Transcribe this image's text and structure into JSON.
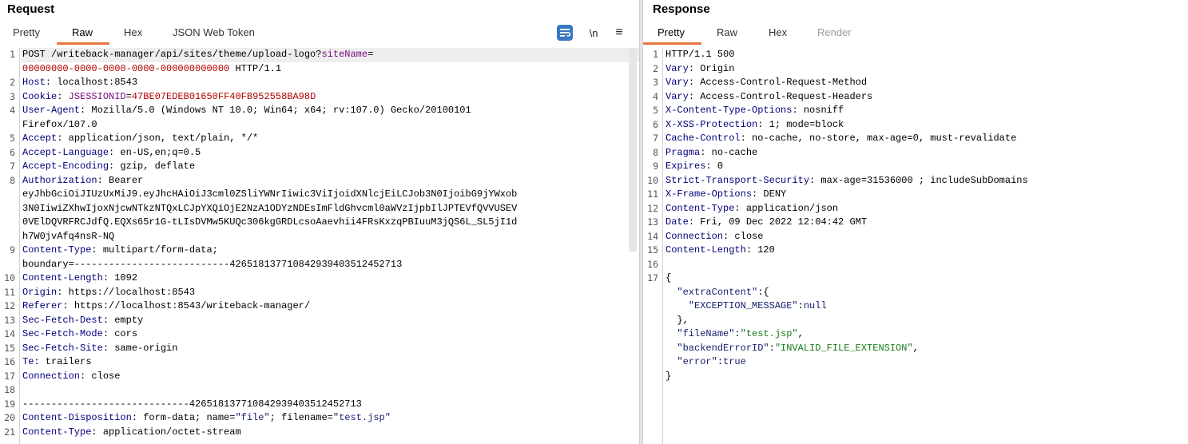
{
  "request": {
    "title": "Request",
    "tabs": [
      "Pretty",
      "Raw",
      "Hex",
      "JSON Web Token"
    ],
    "active_tab": "Raw",
    "toolbar": {
      "newline_label": "\\n",
      "menu_label": "≡"
    },
    "lines": [
      {
        "n": "1",
        "segs": [
          {
            "t": "POST /writeback-manager/api/sites/theme/upload-logo?"
          },
          {
            "t": "siteName",
            "c": "pk"
          },
          {
            "t": "="
          }
        ]
      },
      {
        "n": "",
        "segs": [
          {
            "t": "00000000-0000-0000-0000-000000000000",
            "c": "pv"
          },
          {
            "t": " HTTP/1.1"
          }
        ]
      },
      {
        "n": "2",
        "segs": [
          {
            "t": "Host",
            "c": "k"
          },
          {
            "t": ": localhost:8543"
          }
        ]
      },
      {
        "n": "3",
        "segs": [
          {
            "t": "Cookie",
            "c": "k"
          },
          {
            "t": ": "
          },
          {
            "t": "JSESSIONID",
            "c": "pk"
          },
          {
            "t": "="
          },
          {
            "t": "47BE07EDEB01650FF40FB952558BA98D",
            "c": "pv"
          }
        ]
      },
      {
        "n": "4",
        "segs": [
          {
            "t": "User-Agent",
            "c": "k"
          },
          {
            "t": ": Mozilla/5.0 (Windows NT 10.0; Win64; x64; rv:107.0) Gecko/20100101"
          }
        ]
      },
      {
        "n": "",
        "segs": [
          {
            "t": "Firefox/107.0"
          }
        ]
      },
      {
        "n": "5",
        "segs": [
          {
            "t": "Accept",
            "c": "k"
          },
          {
            "t": ": application/json, text/plain, */*"
          }
        ]
      },
      {
        "n": "6",
        "segs": [
          {
            "t": "Accept-Language",
            "c": "k"
          },
          {
            "t": ": en-US,en;q=0.5"
          }
        ]
      },
      {
        "n": "7",
        "segs": [
          {
            "t": "Accept-Encoding",
            "c": "k"
          },
          {
            "t": ": gzip, deflate"
          }
        ]
      },
      {
        "n": "8",
        "segs": [
          {
            "t": "Authorization",
            "c": "k"
          },
          {
            "t": ": Bearer"
          }
        ]
      },
      {
        "n": "",
        "segs": [
          {
            "t": "eyJhbGciOiJIUzUxMiJ9.eyJhcHAiOiJ3cml0ZSliYWNrIiwic3ViIjoidXNlcjEiLCJob3N0IjoibG9jYWxob"
          }
        ]
      },
      {
        "n": "",
        "segs": [
          {
            "t": "3N0IiwiZXhwIjoxNjcwNTkzNTQxLCJpYXQiOjE2NzA1ODYzNDEsImFldGhvcml0aWVzIjpbIlJPTEVfQVVUSEV"
          }
        ]
      },
      {
        "n": "",
        "segs": [
          {
            "t": "0VElDQVRFRCJdfQ.EQXs65r1G-tLIsDVMw5KUQc306kgGRDLcsoAaevhii4FRsKxzqPBIuuM3jQS6L_SL5jI1d"
          }
        ]
      },
      {
        "n": "",
        "segs": [
          {
            "t": "h7W0jvAfq4nsR-NQ"
          }
        ]
      },
      {
        "n": "9",
        "segs": [
          {
            "t": "Content-Type",
            "c": "k"
          },
          {
            "t": ": multipart/form-data;"
          }
        ]
      },
      {
        "n": "",
        "segs": [
          {
            "t": "boundary=---------------------------426518137710842939403512452713"
          }
        ]
      },
      {
        "n": "10",
        "segs": [
          {
            "t": "Content-Length",
            "c": "k"
          },
          {
            "t": ": 1092"
          }
        ]
      },
      {
        "n": "11",
        "segs": [
          {
            "t": "Origin",
            "c": "k"
          },
          {
            "t": ": https://localhost:8543"
          }
        ]
      },
      {
        "n": "12",
        "segs": [
          {
            "t": "Referer",
            "c": "k"
          },
          {
            "t": ": https://localhost:8543/writeback-manager/"
          }
        ]
      },
      {
        "n": "13",
        "segs": [
          {
            "t": "Sec-Fetch-Dest",
            "c": "k"
          },
          {
            "t": ": empty"
          }
        ]
      },
      {
        "n": "14",
        "segs": [
          {
            "t": "Sec-Fetch-Mode",
            "c": "k"
          },
          {
            "t": ": cors"
          }
        ]
      },
      {
        "n": "15",
        "segs": [
          {
            "t": "Sec-Fetch-Site",
            "c": "k"
          },
          {
            "t": ": same-origin"
          }
        ]
      },
      {
        "n": "16",
        "segs": [
          {
            "t": "Te",
            "c": "k"
          },
          {
            "t": ": trailers"
          }
        ]
      },
      {
        "n": "17",
        "segs": [
          {
            "t": "Connection",
            "c": "k"
          },
          {
            "t": ": close"
          }
        ]
      },
      {
        "n": "18",
        "segs": [
          {
            "t": ""
          }
        ]
      },
      {
        "n": "19",
        "segs": [
          {
            "t": "-----------------------------426518137710842939403512452713"
          }
        ]
      },
      {
        "n": "20",
        "segs": [
          {
            "t": "Content-Disposition",
            "c": "k"
          },
          {
            "t": ": form-data; name="
          },
          {
            "t": "\"file\"",
            "c": "js"
          },
          {
            "t": "; filename="
          },
          {
            "t": "\"test.jsp\"",
            "c": "js"
          }
        ]
      },
      {
        "n": "21",
        "segs": [
          {
            "t": "Content-Type",
            "c": "k"
          },
          {
            "t": ": application/octet-stream"
          }
        ]
      }
    ]
  },
  "response": {
    "title": "Response",
    "tabs": [
      "Pretty",
      "Raw",
      "Hex",
      "Render"
    ],
    "active_tab": "Pretty",
    "lines": [
      {
        "n": "1",
        "segs": [
          {
            "t": "HTTP/1.1 500"
          }
        ]
      },
      {
        "n": "2",
        "segs": [
          {
            "t": "Vary",
            "c": "k"
          },
          {
            "t": ": Origin"
          }
        ]
      },
      {
        "n": "3",
        "segs": [
          {
            "t": "Vary",
            "c": "k"
          },
          {
            "t": ": Access-Control-Request-Method"
          }
        ]
      },
      {
        "n": "4",
        "segs": [
          {
            "t": "Vary",
            "c": "k"
          },
          {
            "t": ": Access-Control-Request-Headers"
          }
        ]
      },
      {
        "n": "5",
        "segs": [
          {
            "t": "X-Content-Type-Options",
            "c": "k"
          },
          {
            "t": ": nosniff"
          }
        ]
      },
      {
        "n": "6",
        "segs": [
          {
            "t": "X-XSS-Protection",
            "c": "k"
          },
          {
            "t": ": 1; mode=block"
          }
        ]
      },
      {
        "n": "7",
        "segs": [
          {
            "t": "Cache-Control",
            "c": "k"
          },
          {
            "t": ": no-cache, no-store, max-age=0, must-revalidate"
          }
        ]
      },
      {
        "n": "8",
        "segs": [
          {
            "t": "Pragma",
            "c": "k"
          },
          {
            "t": ": no-cache"
          }
        ]
      },
      {
        "n": "9",
        "segs": [
          {
            "t": "Expires",
            "c": "k"
          },
          {
            "t": ": 0"
          }
        ]
      },
      {
        "n": "10",
        "segs": [
          {
            "t": "Strict-Transport-Security",
            "c": "k"
          },
          {
            "t": ": max-age=31536000 ; includeSubDomains"
          }
        ]
      },
      {
        "n": "11",
        "segs": [
          {
            "t": "X-Frame-Options",
            "c": "k"
          },
          {
            "t": ": DENY"
          }
        ]
      },
      {
        "n": "12",
        "segs": [
          {
            "t": "Content-Type",
            "c": "k"
          },
          {
            "t": ": application/json"
          }
        ]
      },
      {
        "n": "13",
        "segs": [
          {
            "t": "Date",
            "c": "k"
          },
          {
            "t": ": Fri, 09 Dec 2022 12:04:42 GMT"
          }
        ]
      },
      {
        "n": "14",
        "segs": [
          {
            "t": "Connection",
            "c": "k"
          },
          {
            "t": ": close"
          }
        ]
      },
      {
        "n": "15",
        "segs": [
          {
            "t": "Content-Length",
            "c": "k"
          },
          {
            "t": ": 120"
          }
        ]
      },
      {
        "n": "16",
        "segs": [
          {
            "t": ""
          }
        ]
      },
      {
        "n": "17",
        "segs": [
          {
            "t": "{"
          }
        ]
      },
      {
        "n": "",
        "segs": [
          {
            "t": "  "
          },
          {
            "t": "\"extraContent\"",
            "c": "js"
          },
          {
            "t": ":{"
          }
        ]
      },
      {
        "n": "",
        "segs": [
          {
            "t": "    "
          },
          {
            "t": "\"EXCEPTION_MESSAGE\"",
            "c": "js"
          },
          {
            "t": ":"
          },
          {
            "t": "null",
            "c": "js"
          }
        ]
      },
      {
        "n": "",
        "segs": [
          {
            "t": "  },"
          }
        ]
      },
      {
        "n": "",
        "segs": [
          {
            "t": "  "
          },
          {
            "t": "\"fileName\"",
            "c": "js"
          },
          {
            "t": ":"
          },
          {
            "t": "\"test.jsp\"",
            "c": "jv"
          },
          {
            "t": ","
          }
        ]
      },
      {
        "n": "",
        "segs": [
          {
            "t": "  "
          },
          {
            "t": "\"backendErrorID\"",
            "c": "js"
          },
          {
            "t": ":"
          },
          {
            "t": "\"INVALID_FILE_EXTENSION\"",
            "c": "jv"
          },
          {
            "t": ","
          }
        ]
      },
      {
        "n": "",
        "segs": [
          {
            "t": "  "
          },
          {
            "t": "\"error\"",
            "c": "js"
          },
          {
            "t": ":"
          },
          {
            "t": "true",
            "c": "js"
          }
        ]
      },
      {
        "n": "",
        "segs": [
          {
            "t": "}"
          }
        ]
      }
    ]
  },
  "colors": {
    "accent": "#e8743b",
    "header_key": "#00007a",
    "param_value": "#b00000",
    "json_string": "#1a7a1a",
    "wrap_icon": "#3a78c2"
  }
}
